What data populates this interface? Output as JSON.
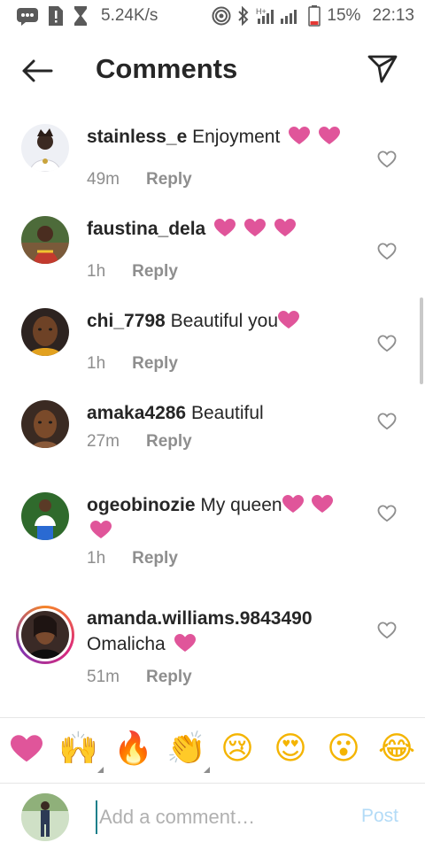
{
  "status_bar": {
    "speed": "5.24K/s",
    "battery": "15%",
    "time": "22:13",
    "icons": [
      "message-icon",
      "sim-alert-icon",
      "hourglass-icon",
      "hotspot-icon",
      "bluetooth-icon",
      "signal-icon",
      "battery-icon"
    ]
  },
  "header": {
    "title": "Comments",
    "back_icon": "arrow-left-icon",
    "send_icon": "paper-plane-icon"
  },
  "comments": [
    {
      "user": "stainless_e",
      "text": "Enjoyment",
      "hearts": 2,
      "time": "49m",
      "reply": "Reply"
    },
    {
      "user": "faustina_dela",
      "text": "",
      "hearts": 3,
      "time": "1h",
      "reply": "Reply"
    },
    {
      "user": "chi_7798",
      "text": "Beautiful you",
      "hearts": 1,
      "time": "1h",
      "reply": "Reply"
    },
    {
      "user": "amaka4286",
      "text": "Beautiful",
      "hearts": 0,
      "time": "27m",
      "reply": "Reply"
    },
    {
      "user": "ogeobinozie",
      "text": "My queen",
      "hearts": 3,
      "time": "1h",
      "reply": "Reply"
    },
    {
      "user": "amanda.williams.9843490",
      "text": "Omalicha",
      "hearts": 1,
      "time": "51m",
      "reply": "Reply"
    }
  ],
  "emoji_bar": [
    "❤",
    "🙌",
    "🔥",
    "👏",
    "😢",
    "😍",
    "😮",
    "😂"
  ],
  "composer": {
    "placeholder": "Add a comment…",
    "post_label": "Post"
  },
  "colors": {
    "heart_pink": "#e0559a",
    "post_disabled": "#b3dbf7",
    "meta_gray": "#8e8e8e"
  }
}
